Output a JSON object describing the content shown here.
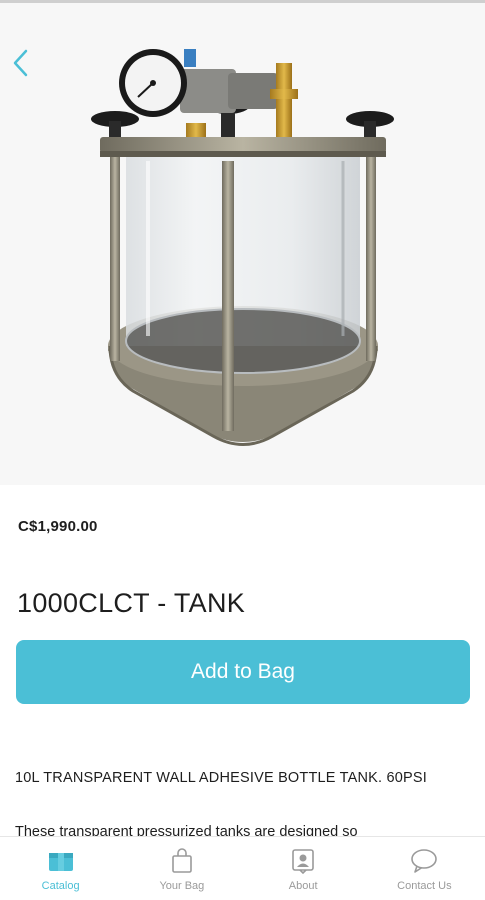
{
  "product": {
    "price": "C$1,990.00",
    "title": "1000CLCT - TANK",
    "image_icon": "pressure-tank-image"
  },
  "actions": {
    "add_to_bag_label": "Add to Bag",
    "back_icon": "chevron-left-icon"
  },
  "description": {
    "heading": "10L TRANSPARENT WALL ADHESIVE BOTTLE TANK. 60PSI",
    "body": "These transparent pressurized tanks are designed so"
  },
  "tabbar": {
    "items": [
      {
        "label": "Catalog",
        "icon": "catalog-icon",
        "active": true
      },
      {
        "label": "Your Bag",
        "icon": "bag-icon",
        "active": false
      },
      {
        "label": "About",
        "icon": "about-icon",
        "active": false
      },
      {
        "label": "Contact Us",
        "icon": "chat-bubble-icon",
        "active": false
      }
    ]
  },
  "colors": {
    "accent": "#4bbfd6",
    "inactive": "#9a9a9a",
    "text": "#1e1e1e"
  }
}
